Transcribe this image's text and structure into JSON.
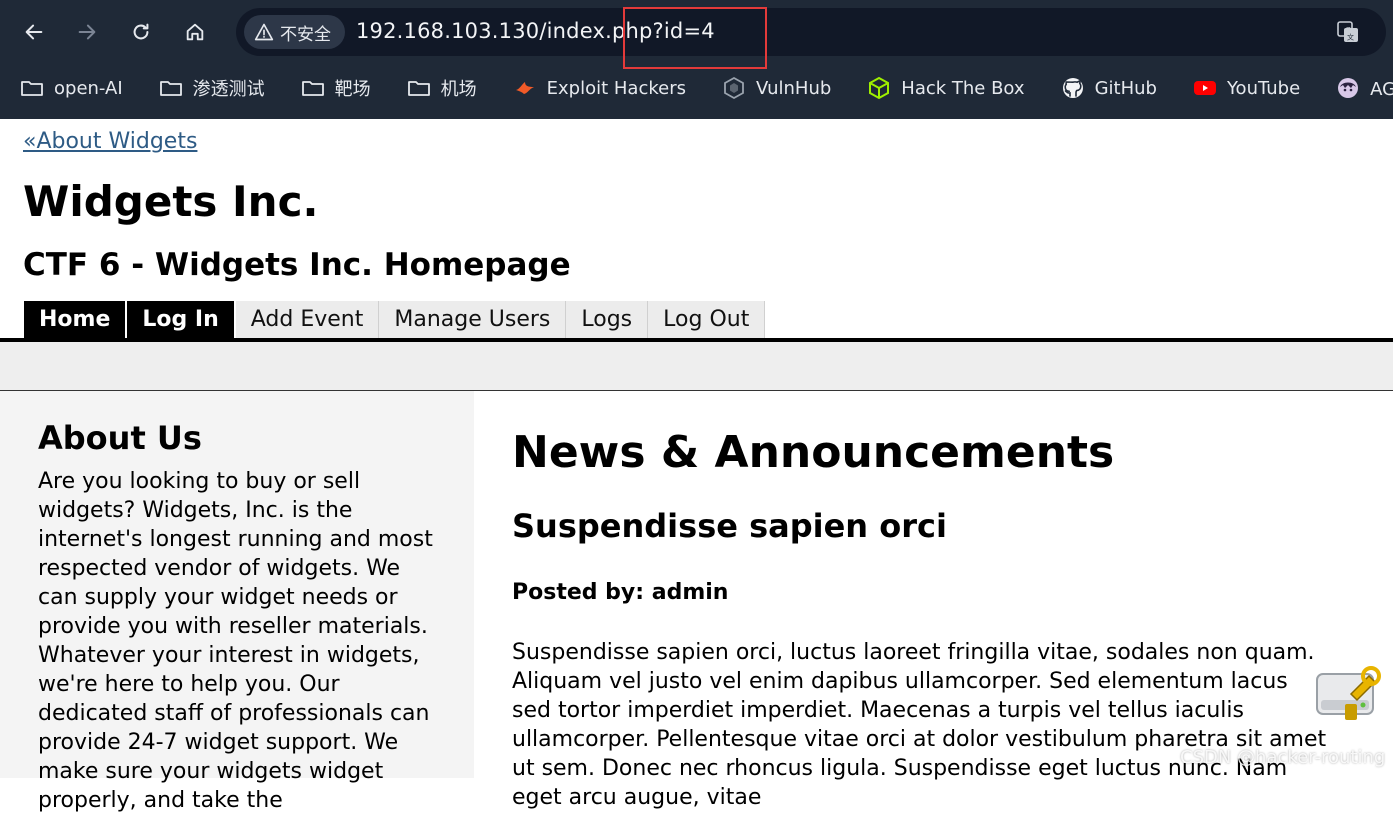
{
  "browser": {
    "security_label": "不安全",
    "url": "192.168.103.130/index.php?id=4",
    "bookmarks": [
      {
        "label": "open-AI",
        "icon": "folder-icon"
      },
      {
        "label": "渗透测试",
        "icon": "folder-icon"
      },
      {
        "label": "靶场",
        "icon": "folder-icon"
      },
      {
        "label": "机场",
        "icon": "folder-icon"
      },
      {
        "label": "Exploit Hackers",
        "icon": "exploit-hackers-icon"
      },
      {
        "label": "VulnHub",
        "icon": "vulnhub-icon"
      },
      {
        "label": "Hack The Box",
        "icon": "hackthebox-icon"
      },
      {
        "label": "GitHub",
        "icon": "github-icon"
      },
      {
        "label": "YouTube",
        "icon": "youtube-icon"
      },
      {
        "label": "AGE动漫",
        "icon": "age-anime-icon"
      }
    ],
    "highlight_color": "#e33a3a"
  },
  "page": {
    "back_link": "«About Widgets",
    "site_title": "Widgets Inc.",
    "ctf_title": "CTF 6 - Widgets Inc. Homepage",
    "nav": [
      {
        "label": "Home",
        "style": "dark"
      },
      {
        "label": "Log In",
        "style": "dark"
      },
      {
        "label": "Add Event",
        "style": "light"
      },
      {
        "label": "Manage Users",
        "style": "light"
      },
      {
        "label": "Logs",
        "style": "light"
      },
      {
        "label": "Log Out",
        "style": "light"
      }
    ],
    "sidebar": {
      "title": "About Us",
      "text": "Are you looking to buy or sell widgets? Widgets, Inc. is the internet's longest running and most respected vendor of widgets. We can supply your widget needs or provide you with reseller materials. Whatever your interest in widgets, we're here to help you. Our dedicated staff of professionals can provide 24-7 widget support. We make sure your widgets widget properly, and take the"
    },
    "main": {
      "title": "News & Announcements",
      "post_title": "Suspendisse sapien orci",
      "post_author": "Posted by: admin",
      "post_body": "Suspendisse sapien orci, luctus laoreet fringilla vitae, sodales non quam. Aliquam vel justo vel enim dapibus ullamcorper. Sed elementum lacus sed tortor imperdiet imperdiet. Maecenas a turpis vel tellus iaculis ullamcorper. Pellentesque vitae orci at dolor vestibulum pharetra sit amet ut sem. Donec nec rhoncus ligula. Suspendisse eget luctus nunc. Nam eget arcu augue, vitae"
    }
  },
  "watermark": "CSDN @hacker-routing"
}
